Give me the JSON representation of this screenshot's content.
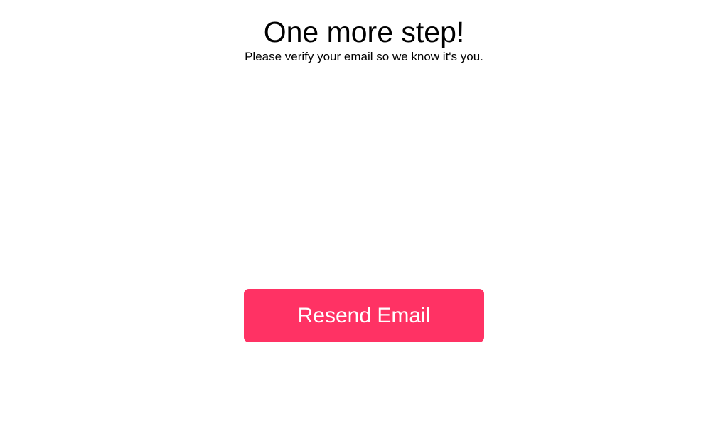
{
  "header": {
    "title": "One more step!",
    "subtitle": "Please verify your email so we know it's you."
  },
  "actions": {
    "resend_label": "Resend Email"
  },
  "colors": {
    "accent": "#ff3264",
    "background": "#ffffff",
    "text": "#000000"
  }
}
